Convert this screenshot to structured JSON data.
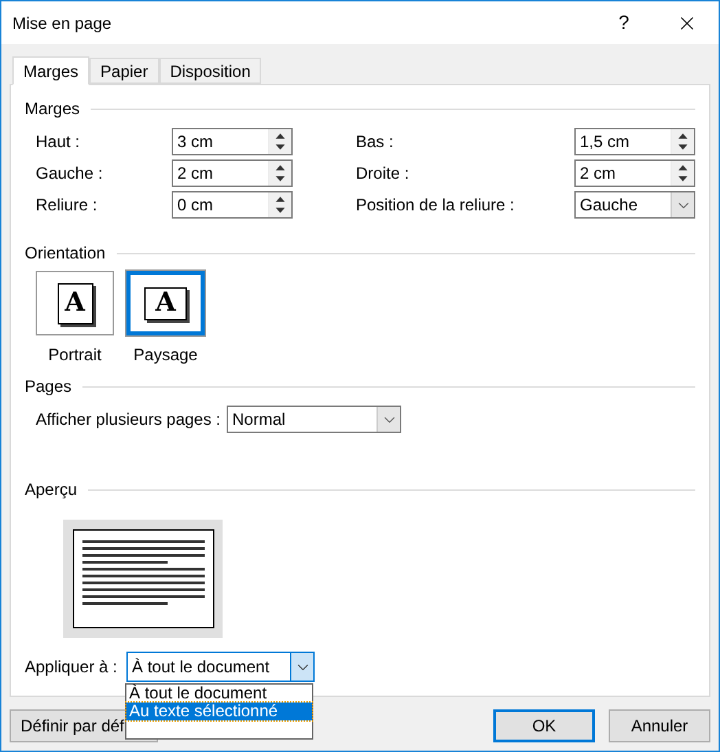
{
  "window": {
    "title": "Mise en page",
    "help": "?"
  },
  "tabs": [
    {
      "label": "Marges",
      "selected": true
    },
    {
      "label": "Papier",
      "selected": false
    },
    {
      "label": "Disposition",
      "selected": false
    }
  ],
  "margins": {
    "heading": "Marges",
    "rows": [
      [
        {
          "label": "Haut :",
          "value": "3 cm",
          "kind": "spin"
        },
        {
          "label": "Bas :",
          "value": "1,5 cm",
          "kind": "spin"
        }
      ],
      [
        {
          "label": "Gauche :",
          "value": "2 cm",
          "kind": "spin"
        },
        {
          "label": "Droite :",
          "value": "2 cm",
          "kind": "spin"
        }
      ],
      [
        {
          "label": "Reliure :",
          "value": "0 cm",
          "kind": "spin"
        },
        {
          "label": "Position de la reliure :",
          "value": "Gauche",
          "kind": "select"
        }
      ]
    ]
  },
  "orientation": {
    "heading": "Orientation",
    "options": [
      {
        "label": "Portrait",
        "glyph": "A",
        "kind": "portrait",
        "selected": false
      },
      {
        "label": "Paysage",
        "glyph": "A",
        "kind": "landscape",
        "selected": true
      }
    ]
  },
  "pages": {
    "heading": "Pages",
    "label": "Afficher plusieurs pages :",
    "value": "Normal"
  },
  "preview": {
    "heading": "Aperçu"
  },
  "apply": {
    "label": "Appliquer à :",
    "value": "À tout le document",
    "expanded": true,
    "options": [
      {
        "label": "À tout le document",
        "highlighted": false
      },
      {
        "label": "Au texte sélectionné",
        "highlighted": true
      }
    ]
  },
  "buttons": [
    {
      "label": "Définir par déf",
      "kind": "secondary"
    },
    {
      "label": "OK",
      "kind": "primary"
    },
    {
      "label": "Annuler",
      "kind": "secondary"
    }
  ]
}
